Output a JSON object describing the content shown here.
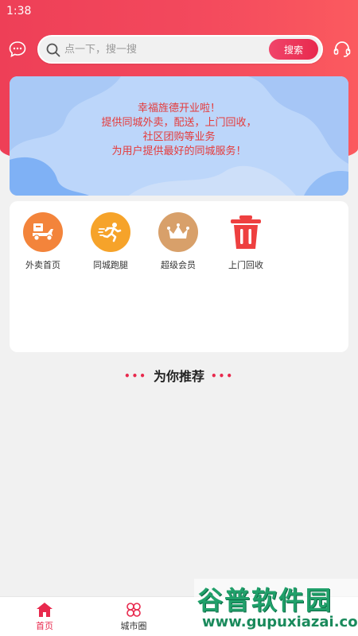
{
  "status_bar": {
    "time": "1:38"
  },
  "search": {
    "placeholder": "点一下，搜一搜",
    "button_label": "搜索"
  },
  "banner": {
    "lines": [
      "幸福旌德开业啦！",
      "提供同城外卖，配送，上门回收，",
      "社区团购等业务",
      "为用户提供最好的同城服务！"
    ]
  },
  "menu": {
    "items": [
      {
        "label": "外卖首页",
        "icon": "delivery-scooter-icon",
        "color": "#f3843b"
      },
      {
        "label": "同城跑腿",
        "icon": "running-man-icon",
        "color": "#f6a32a"
      },
      {
        "label": "超级会员",
        "icon": "crown-icon",
        "color": "#d8a06a"
      },
      {
        "label": "上门回收",
        "icon": "trash-bin-icon",
        "color": "#ee4040"
      }
    ]
  },
  "recommend": {
    "title": "为你推荐",
    "dots_left": "•••",
    "dots_right": "•••"
  },
  "bottom_nav": {
    "items": [
      {
        "label": "首页",
        "icon": "home-icon",
        "active": true
      },
      {
        "label": "城市圈",
        "icon": "grid-circles-icon",
        "active": false
      }
    ]
  },
  "watermark": {
    "title": "谷普软件园",
    "url": "www.gupuxiazai.com"
  },
  "colors": {
    "accent": "#e8294d",
    "header_start": "#ee3f57",
    "banner_bg": "#bcd6fa",
    "banner_text": "#e53a3a"
  }
}
